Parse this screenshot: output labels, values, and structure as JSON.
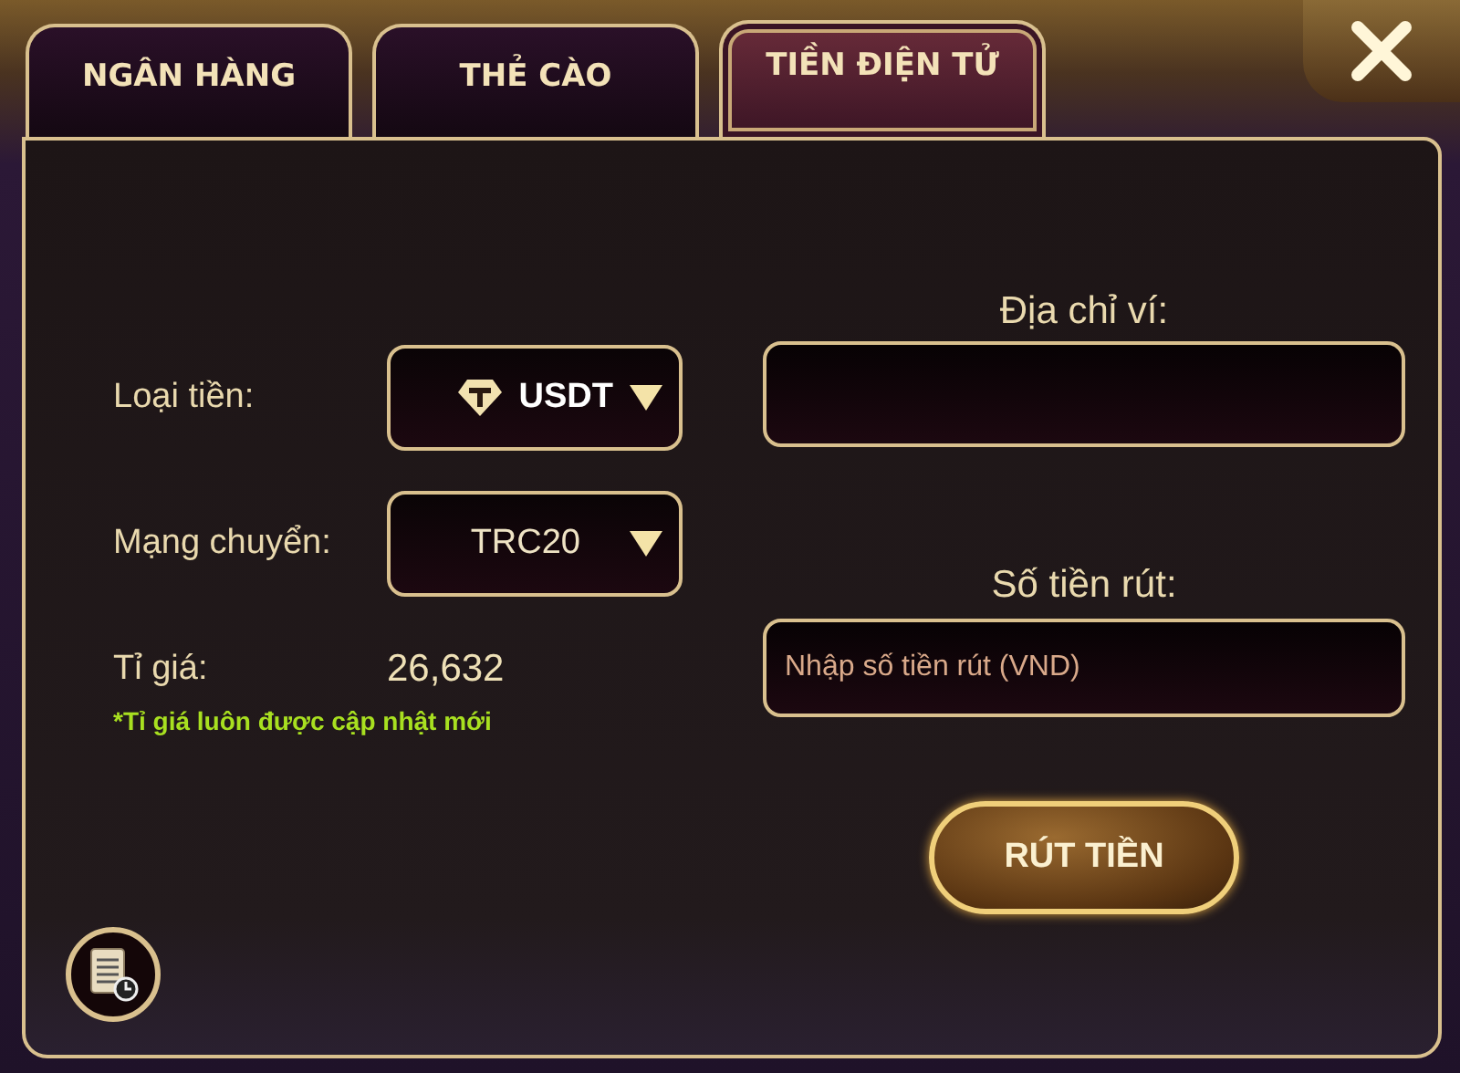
{
  "tabs": [
    {
      "label": "NGÂN HÀNG",
      "selected": false
    },
    {
      "label": "THẺ CÀO",
      "selected": false
    },
    {
      "label": "TIỀN ĐIỆN TỬ",
      "selected": true
    }
  ],
  "form": {
    "currency": {
      "label": "Loại tiền:",
      "value": "USDT"
    },
    "network": {
      "label": "Mạng chuyển:",
      "value": "TRC20"
    },
    "rate": {
      "label": "Tỉ giá:",
      "value": "26,632",
      "note": "*Tỉ giá luôn được cập nhật mới"
    },
    "wallet_address": {
      "label": "Địa chỉ ví:"
    },
    "amount": {
      "label": "Số tiền rút:",
      "placeholder": "Nhập số tiền rút (VND)"
    },
    "submit": "RÚT TIỀN"
  }
}
